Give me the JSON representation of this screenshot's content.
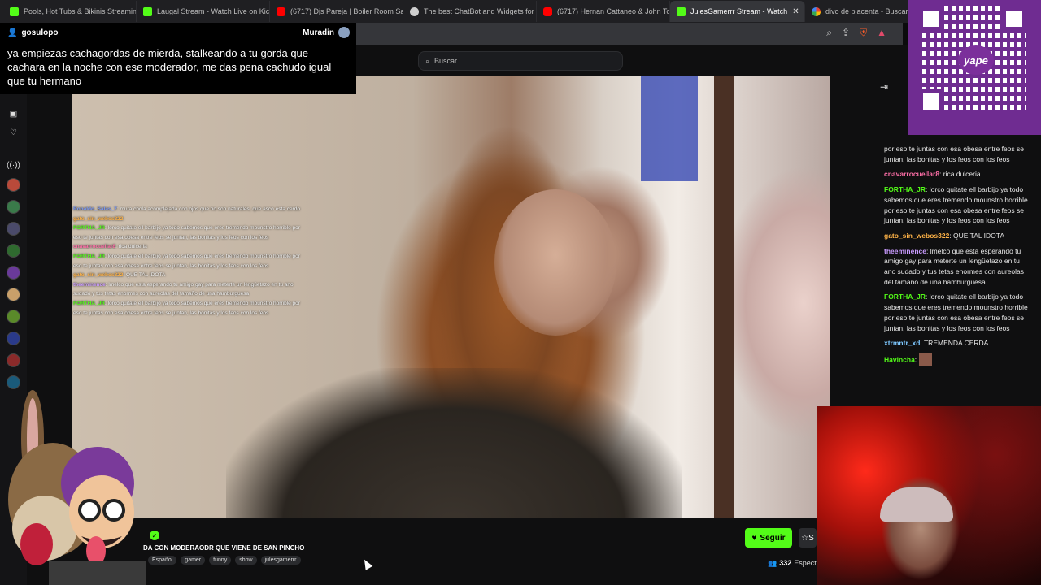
{
  "browser": {
    "tabs": [
      {
        "title": "Pools, Hot Tubs & Bikinis Streaming",
        "icon": "kick-icon"
      },
      {
        "title": "Laugal Stream - Watch Live on Kick",
        "icon": "kick-icon"
      },
      {
        "title": "(6717) Djs Pareja | Boiler Room Santi",
        "icon": "youtube-icon"
      },
      {
        "title": "The best ChatBot and Widgets for K",
        "icon": "generic-icon"
      },
      {
        "title": "(6717) Hernan Cattaneo & John Toni",
        "icon": "youtube-icon"
      },
      {
        "title": "JulesGamerrr Stream - Watch",
        "icon": "kick-icon"
      },
      {
        "title": "divo de placenta - Buscar con G",
        "icon": "google-icon"
      }
    ],
    "active_tab_index": 5
  },
  "alert": {
    "username": "gosulopo",
    "badge": "Muradin",
    "message": "ya empiezas cachagordas de mierda, stalkeando a tu gorda que cachara en la noche con ese moderador, me das pena cachudo igual que tu hermano"
  },
  "search": {
    "placeholder": "Buscar"
  },
  "overlay_chat": [
    {
      "user": "Ronaldo_Salas_7",
      "text": "mura chola acomplejada con ojos que no son naturales, que asco esta cerdo",
      "color": "#7b9cff"
    },
    {
      "user": "gato_sin_webos322",
      "text": "",
      "color": "#ffb347"
    },
    {
      "user": "FORTHA_JR",
      "text": "lorco quitate ell barbijo ya todo sabemos que eres tremendo mounstro horrible por eso te juntas con esa obesa entre feos se juntan, las bonitas y los feos con los feos",
      "color": "#53fc18"
    },
    {
      "user": "cnavarrocuellar8",
      "text": "rica dulceria",
      "color": "#ff6fa8"
    },
    {
      "user": "FORTHA_JR",
      "text": "lorco quitate ell barbijo ya todo sabemos que eres tremendo mounstro horrible por eso te juntas con esa obesa entre feos se juntan, las bonitas y los feos con los feos",
      "color": "#53fc18"
    },
    {
      "user": "gato_sin_webos322",
      "text": "QUE TAL IDOTA",
      "color": "#ffb347"
    },
    {
      "user": "theeminence",
      "text": "lmelco que esta esperando tu amigo gay para meterte un lengüetazo en tu ano sudado y tus tetas enormes con aureolas del tamaño de una hamburguesa",
      "color": "#c99bff"
    },
    {
      "user": "FORTHA_JR",
      "text": "lorco quitate ell barbijo ya todo sabemos que eres tremendo mounstro horrible por eso te juntas con esa obesa entre feos se juntan, las bonitas y los feos con los feos",
      "color": "#53fc18"
    }
  ],
  "stream": {
    "title": "DA CON MODERAODR QUE VIENE DE SAN PINCHO",
    "tags": [
      "Español",
      "gamer",
      "funny",
      "show",
      "julesgamerrr"
    ],
    "follow_label": "Seguir",
    "sub_label": "S",
    "viewers_count": "332",
    "viewers_label": "Especta"
  },
  "chat": [
    {
      "user": "",
      "text": "por eso te juntas con esa obesa entre feos se juntan, las bonitas y los feos con los feos",
      "color": "#53fc18"
    },
    {
      "user": "cnavarrocuellar8",
      "text": "rica dulceria",
      "color": "#ff6fa8"
    },
    {
      "user": "FORTHA_JR",
      "text": "lorco quitate ell barbijo ya todo sabemos que eres tremendo mounstro horrible por eso te juntas con esa obesa entre feos se juntan, las bonitas y los feos con los feos",
      "color": "#53fc18"
    },
    {
      "user": "gato_sin_webos322",
      "text": "QUE TAL IDOTA",
      "color": "#ffb347"
    },
    {
      "user": "theeminence",
      "text": "lmelco que está esperando tu amigo gay para meterte un lengüetazo en tu ano sudado y tus tetas enormes con aureolas del tamaño de una hamburguesa",
      "color": "#c99bff"
    },
    {
      "user": "FORTHA_JR",
      "text": "lorco quitate ell barbijo ya todo sabemos que eres tremendo mounstro horrible por eso te juntas con esa obesa entre feos se juntan, las bonitas y los feos con los feos",
      "color": "#53fc18"
    },
    {
      "user": "xtrmntr_xd",
      "text": "TREMENDA CERDA",
      "color": "#7ec8ff"
    },
    {
      "user": "Havincha",
      "text": "",
      "color": "#53fc18"
    }
  ],
  "qr": {
    "brand": "yape"
  },
  "colors": {
    "kick_green": "#53fc18",
    "yape_purple": "#6f2c91"
  }
}
